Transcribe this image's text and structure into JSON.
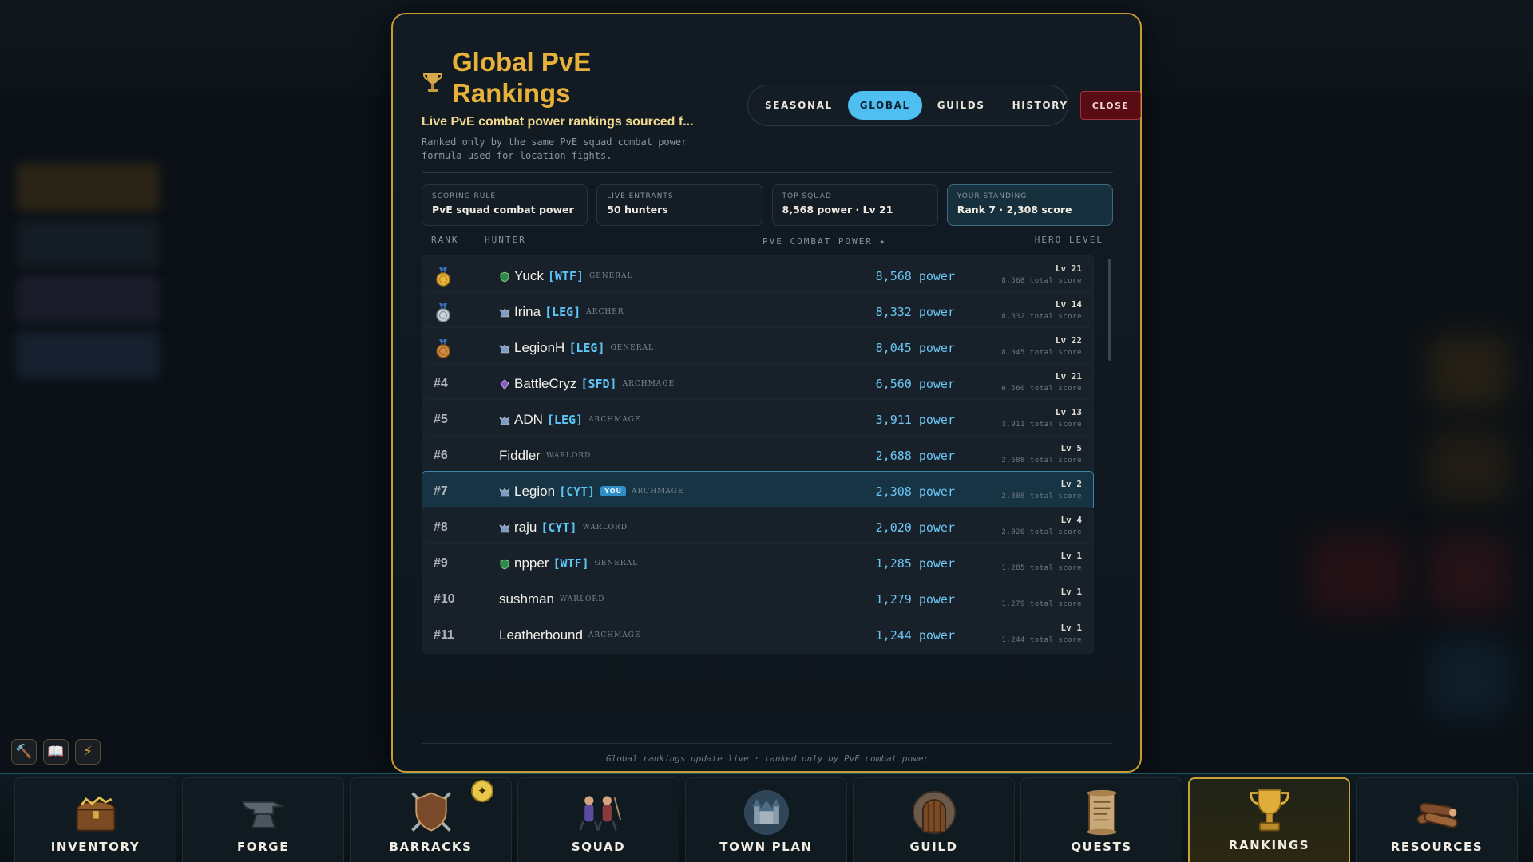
{
  "header": {
    "title": "Global PvE Rankings",
    "subtitle": "Live PvE combat power rankings sourced f...",
    "description": "Ranked only by the same PvE squad combat power formula used for location fights."
  },
  "tabs": [
    {
      "label": "SEASONAL",
      "active": false
    },
    {
      "label": "GLOBAL",
      "active": true
    },
    {
      "label": "GUILDS",
      "active": false
    },
    {
      "label": "HISTORY",
      "active": false
    }
  ],
  "close_label": "CLOSE",
  "stats": [
    {
      "label": "SCORING RULE",
      "value": "PvE squad combat power"
    },
    {
      "label": "LIVE ENTRANTS",
      "value": "50 hunters"
    },
    {
      "label": "TOP SQUAD",
      "value": "8,568 power · Lv 21"
    },
    {
      "label": "YOUR STANDING",
      "value": "Rank 7 · 2,308 score"
    }
  ],
  "columns": {
    "rank": "RANK",
    "hunter": "HUNTER",
    "power": "PVE COMBAT POWER ✦",
    "level": "HERO LEVEL"
  },
  "you_badge": "YOU",
  "rows": [
    {
      "rank": "1",
      "medal": "gold",
      "name": "Yuck",
      "tag": "[WTF]",
      "class": "GENERAL",
      "guild_icon": "green-shield-icon",
      "power": "8,568 power",
      "level": "Lv 21",
      "score": "8,568 total score"
    },
    {
      "rank": "2",
      "medal": "silver",
      "name": "Irina",
      "tag": "[LEG]",
      "class": "ARCHER",
      "guild_icon": "winged-crest-icon",
      "power": "8,332 power",
      "level": "Lv 14",
      "score": "8,332 total score"
    },
    {
      "rank": "3",
      "medal": "bronze",
      "name": "LegionH",
      "tag": "[LEG]",
      "class": "GENERAL",
      "guild_icon": "winged-crest-icon",
      "power": "8,045 power",
      "level": "Lv 22",
      "score": "8,045 total score"
    },
    {
      "rank": "#4",
      "name": "BattleCryz",
      "tag": "[SFD]",
      "class": "ARCHMAGE",
      "guild_icon": "purple-gem-icon",
      "power": "6,560 power",
      "level": "Lv 21",
      "score": "6,560 total score"
    },
    {
      "rank": "#5",
      "name": "ADN",
      "tag": "[LEG]",
      "class": "ARCHMAGE",
      "guild_icon": "winged-crest-icon",
      "power": "3,911 power",
      "level": "Lv 13",
      "score": "3,911 total score"
    },
    {
      "rank": "#6",
      "name": "Fiddler",
      "tag": "",
      "class": "WARLORD",
      "guild_icon": "",
      "power": "2,688 power",
      "level": "Lv 5",
      "score": "2,688 total score"
    },
    {
      "rank": "#7",
      "name": "Legion",
      "tag": "[CYT]",
      "class": "ARCHMAGE",
      "guild_icon": "winged-crest-icon",
      "power": "2,308 power",
      "level": "Lv 2",
      "score": "2,308 total score",
      "you": true
    },
    {
      "rank": "#8",
      "name": "raju",
      "tag": "[CYT]",
      "class": "WARLORD",
      "guild_icon": "winged-crest-icon",
      "power": "2,020 power",
      "level": "Lv 4",
      "score": "2,020 total score"
    },
    {
      "rank": "#9",
      "name": "npper",
      "tag": "[WTF]",
      "class": "GENERAL",
      "guild_icon": "green-shield-icon",
      "power": "1,285 power",
      "level": "Lv 1",
      "score": "1,285 total score"
    },
    {
      "rank": "#10",
      "name": "sushman",
      "tag": "",
      "class": "WARLORD",
      "guild_icon": "",
      "power": "1,279 power",
      "level": "Lv 1",
      "score": "1,279 total score"
    },
    {
      "rank": "#11",
      "name": "Leatherbound",
      "tag": "",
      "class": "ARCHMAGE",
      "guild_icon": "",
      "power": "1,244 power",
      "level": "Lv 1",
      "score": "1,244 total score"
    }
  ],
  "footer": "Global rankings update live · ranked only by PvE combat power",
  "quick_actions": [
    {
      "icon": "hammer-icon",
      "glyph": "🔨"
    },
    {
      "icon": "book-icon",
      "glyph": "📖"
    },
    {
      "icon": "lightning-icon",
      "glyph": "⚡"
    }
  ],
  "nav": [
    {
      "label": "INVENTORY",
      "icon": "treasure-chest-icon"
    },
    {
      "label": "FORGE",
      "icon": "anvil-icon"
    },
    {
      "label": "BARRACKS",
      "icon": "shield-swords-icon",
      "badge": "✦"
    },
    {
      "label": "SQUAD",
      "icon": "heroes-icon"
    },
    {
      "label": "TOWN PLAN",
      "icon": "castle-icon"
    },
    {
      "label": "GUILD",
      "icon": "guild-door-icon"
    },
    {
      "label": "QUESTS",
      "icon": "scroll-icon"
    },
    {
      "label": "RANKINGS",
      "icon": "trophy-icon",
      "active": true
    },
    {
      "label": "RESOURCES",
      "icon": "logs-icon"
    }
  ],
  "colors": {
    "accent_gold": "#e8b23a",
    "accent_blue": "#4fbff2",
    "danger": "#5a0c14"
  }
}
